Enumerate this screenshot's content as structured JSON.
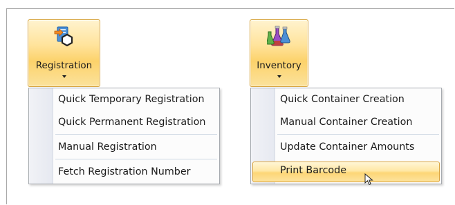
{
  "registration": {
    "label": "Registration",
    "icon": "registration-hexagon-icon",
    "menu": [
      {
        "label": "Quick Temporary Registration"
      },
      {
        "label": "Quick Permanent Registration"
      },
      {
        "label": "Manual Registration"
      },
      {
        "label": "Fetch Registration Number"
      }
    ]
  },
  "inventory": {
    "label": "Inventory",
    "icon": "lab-flasks-icon",
    "menu": [
      {
        "label": "Quick Container Creation"
      },
      {
        "label": "Manual Container Creation"
      },
      {
        "label": "Update Container Amounts"
      },
      {
        "label": "Print Barcode",
        "highlighted": true
      }
    ]
  },
  "colors": {
    "button_highlight": "#fcd26b",
    "button_border": "#d6a23a",
    "menu_border": "#a7abb0",
    "separator": "#c9d3e0"
  }
}
